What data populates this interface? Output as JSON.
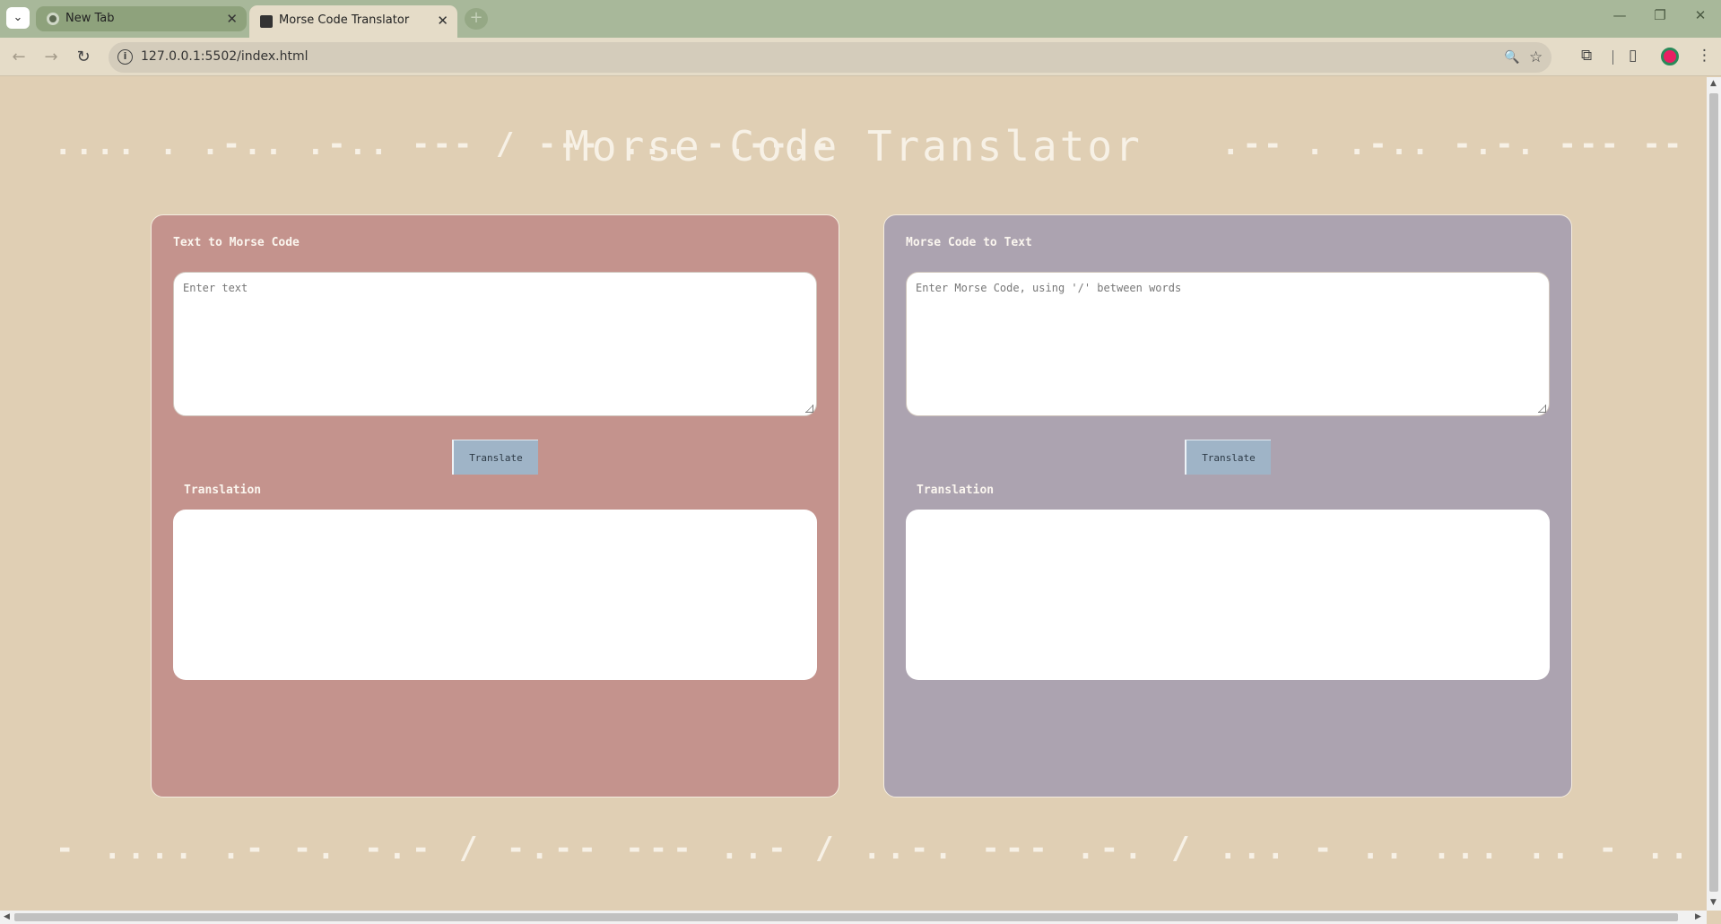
{
  "browser": {
    "tabs": [
      {
        "label": "New Tab",
        "active": false
      },
      {
        "label": "Morse Code Translator",
        "active": true
      }
    ],
    "new_tab_symbol": "+",
    "url": "127.0.0.1:5502/index.html",
    "icons": {
      "back": "←",
      "forward": "→",
      "reload": "↻",
      "info": "i",
      "zoom": "🔍",
      "bookmark": "☆",
      "extensions": "⧉",
      "sidepanel": "▯",
      "menu": "⋮",
      "minimize": "—",
      "restore": "❐",
      "close": "✕",
      "tab_close": "✕",
      "tab_list": "⌄"
    }
  },
  "page": {
    "morse_left": ".... . .-.. .-.. --- / --- ... -.--.-",
    "title": "Morse Code Translator",
    "morse_right": ".-- . .-.. -.-. --- -- . -.-.--",
    "morse_bottom": "- .... .- -. -.- / -.-- --- ..- / ..-. --- .-. / ... - .. ... .. - .. -. --. -.-.--",
    "left_panel": {
      "heading": "Text to Morse Code",
      "input_placeholder": "Enter text",
      "button_label": "Translate",
      "translation_label": "Translation"
    },
    "right_panel": {
      "heading": "Morse Code to Text",
      "input_placeholder": "Enter Morse Code, using '/' between words",
      "button_label": "Translate",
      "translation_label": "Translation"
    },
    "colors": {
      "background": "#e0cfb4",
      "left_panel": "#c4938d",
      "right_panel": "#aca3b0",
      "button": "#9fb4c7"
    }
  }
}
